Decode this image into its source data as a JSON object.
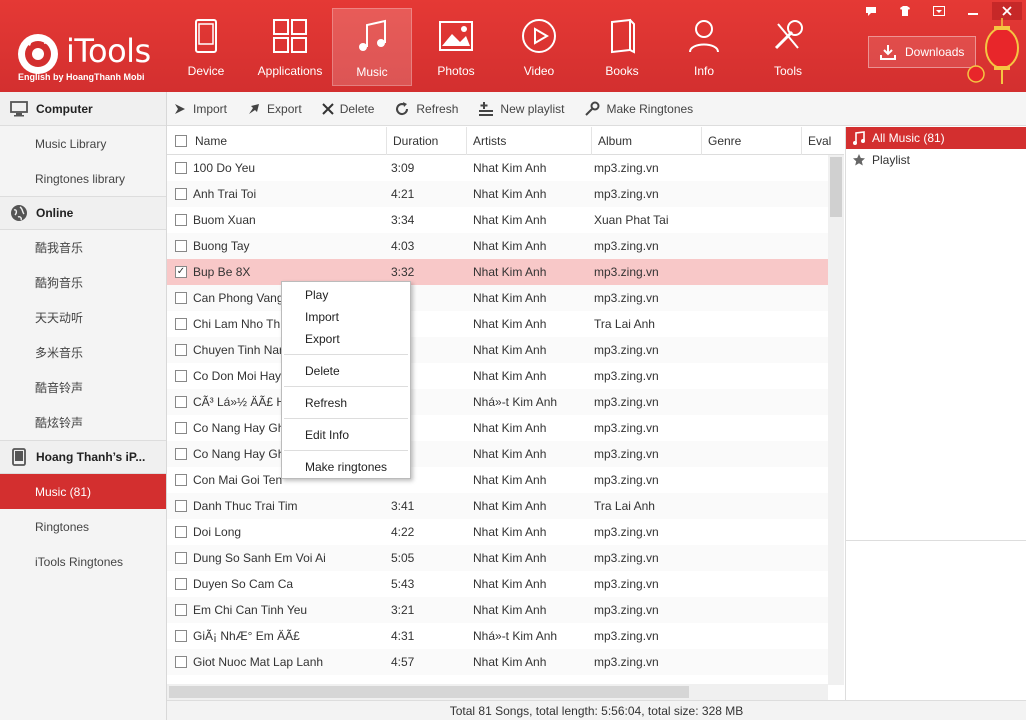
{
  "app": {
    "title": "iTools",
    "subtitle": "English by HoangThanh Mobi"
  },
  "nav": [
    {
      "label": "Device",
      "icon": "device-icon"
    },
    {
      "label": "Applications",
      "icon": "applications-icon"
    },
    {
      "label": "Music",
      "icon": "music-icon",
      "active": true
    },
    {
      "label": "Photos",
      "icon": "photos-icon"
    },
    {
      "label": "Video",
      "icon": "video-icon"
    },
    {
      "label": "Books",
      "icon": "books-icon"
    },
    {
      "label": "Info",
      "icon": "info-icon"
    },
    {
      "label": "Tools",
      "icon": "tools-icon"
    }
  ],
  "downloads": {
    "label": "Downloads"
  },
  "sidebar": {
    "computer": {
      "label": "Computer",
      "items": [
        "Music Library",
        "Ringtones library"
      ]
    },
    "online": {
      "label": "Online",
      "items": [
        "酷我音乐",
        "酷狗音乐",
        "天天动听",
        "多米音乐",
        "酷音铃声",
        "酷炫铃声"
      ]
    },
    "device": {
      "label": "Hoang Thanh’s iP...",
      "items": [
        "Music (81)",
        "Ringtones",
        "iTools Ringtones"
      ],
      "active": "Music (81)"
    }
  },
  "toolbar": {
    "import": "Import",
    "export": "Export",
    "delete": "Delete",
    "refresh": "Refresh",
    "new_playlist": "New playlist",
    "make_ringtones": "Make Ringtones"
  },
  "table": {
    "headers": {
      "name": "Name",
      "duration": "Duration",
      "artists": "Artists",
      "album": "Album",
      "genre": "Genre",
      "eval": "Eval"
    },
    "rows": [
      {
        "name": "100 Do Yeu",
        "duration": "3:09",
        "artist": "Nhat Kim Anh",
        "album": "mp3.zing.vn"
      },
      {
        "name": "Anh Trai Toi",
        "duration": "4:21",
        "artist": "Nhat Kim Anh",
        "album": "mp3.zing.vn"
      },
      {
        "name": "Buom Xuan",
        "duration": "3:34",
        "artist": "Nhat Kim Anh",
        "album": "Xuan Phat Tai"
      },
      {
        "name": "Buong Tay",
        "duration": "4:03",
        "artist": "Nhat Kim Anh",
        "album": "mp3.zing.vn"
      },
      {
        "name": "Bup Be 8X",
        "duration": "3:32",
        "artist": "Nhat Kim Anh",
        "album": "mp3.zing.vn",
        "selected": true
      },
      {
        "name": "Can Phong Vang",
        "duration": "",
        "artist": "Nhat Kim Anh",
        "album": "mp3.zing.vn"
      },
      {
        "name": "Chi Lam Nho Th",
        "duration": "",
        "artist": "Nhat Kim Anh",
        "album": "Tra Lai Anh"
      },
      {
        "name": "Chuyen Tinh Nar",
        "duration": "",
        "artist": "Nhat Kim Anh",
        "album": "mp3.zing.vn"
      },
      {
        "name": "Co Don Moi Hay",
        "duration": "",
        "artist": "Nhat Kim Anh",
        "album": "mp3.zing.vn"
      },
      {
        "name": "CÃ³ Lá»½ ÄÃ£ H",
        "duration": "",
        "artist": "Nhá»‑t Kim Anh",
        "album": "mp3.zing.vn"
      },
      {
        "name": "Co Nang Hay Gh",
        "duration": "",
        "artist": "Nhat Kim Anh",
        "album": "mp3.zing.vn"
      },
      {
        "name": "Co Nang Hay Gh",
        "duration": "",
        "artist": "Nhat Kim Anh",
        "album": "mp3.zing.vn"
      },
      {
        "name": "Con Mai Goi Ten",
        "duration": "",
        "artist": "Nhat Kim Anh",
        "album": "mp3.zing.vn"
      },
      {
        "name": "Danh Thuc Trai Tim",
        "duration": "3:41",
        "artist": "Nhat Kim Anh",
        "album": "Tra Lai Anh"
      },
      {
        "name": "Doi Long",
        "duration": "4:22",
        "artist": "Nhat Kim Anh",
        "album": "mp3.zing.vn"
      },
      {
        "name": "Dung So Sanh Em Voi Ai",
        "duration": "5:05",
        "artist": "Nhat Kim Anh",
        "album": "mp3.zing.vn"
      },
      {
        "name": "Duyen So Cam Ca",
        "duration": "5:43",
        "artist": "Nhat Kim Anh",
        "album": "mp3.zing.vn"
      },
      {
        "name": "Em Chi Can Tinh Yeu",
        "duration": "3:21",
        "artist": "Nhat Kim Anh",
        "album": "mp3.zing.vn"
      },
      {
        "name": "GiÃ¡ NhÆ° Em ÄÃ£",
        "duration": "4:31",
        "artist": "Nhá»‑t Kim Anh",
        "album": "mp3.zing.vn"
      },
      {
        "name": "Giot Nuoc Mat Lap Lanh",
        "duration": "4:57",
        "artist": "Nhat Kim Anh",
        "album": "mp3.zing.vn"
      }
    ]
  },
  "context_menu": {
    "play": "Play",
    "import": "Import",
    "export": "Export",
    "delete": "Delete",
    "refresh": "Refresh",
    "edit_info": "Edit Info",
    "make_ringtones": "Make ringtones"
  },
  "right_panel": {
    "all_music": "All Music (81)",
    "playlist": "Playlist"
  },
  "status": {
    "summary": "Total 81 Songs, total length: 5:56:04, total size: 328 MB"
  },
  "colors": {
    "accent": "#d32f2f",
    "selected_row": "#f8c8c8"
  }
}
